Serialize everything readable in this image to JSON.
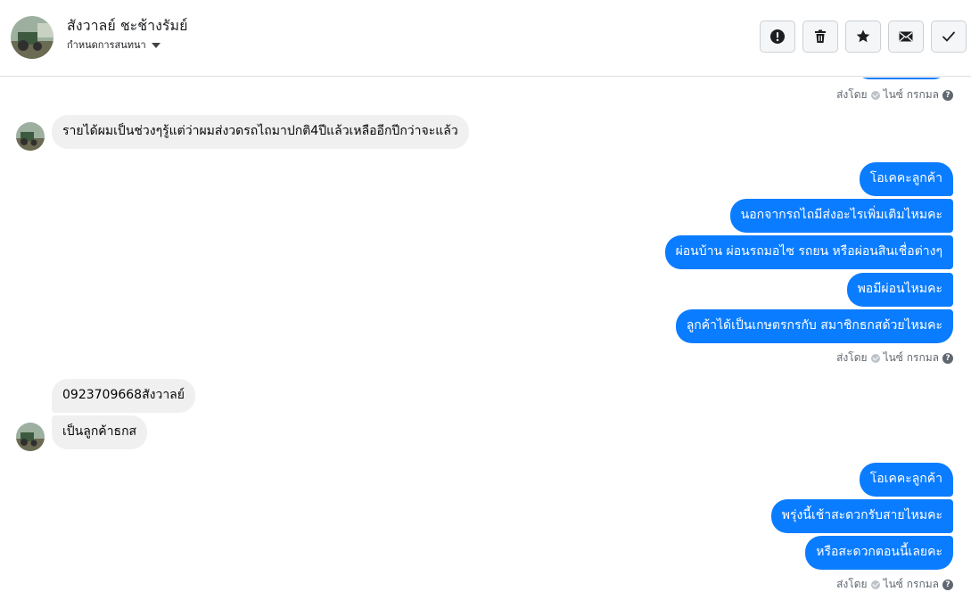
{
  "header": {
    "contact_name": "สังวาลย์ ชะช้างรัมย์",
    "settings_label": "กำหนดการสนทนา"
  },
  "actions": {
    "icons": [
      "alert-icon",
      "trash-icon",
      "star-icon",
      "envelope-icon",
      "check-icon"
    ]
  },
  "sent_by": {
    "prefix": "ส่งโดย",
    "name": "ไนซ์ กรกมล",
    "help": "?"
  },
  "messages": [
    {
      "direction": "in",
      "text": "รายได้ผมเป็นช่วงๆรู้แต่ว่าผมส่งวดรถไถมาปกติ4ปีแล้วเหลืออีกปีกว่าจะแล้ว"
    },
    {
      "direction": "out",
      "text": "โอเคคะลูกค้า"
    },
    {
      "direction": "out",
      "text": "นอกจากรถไถมีส่งอะไรเพิ่มเติมไหมคะ"
    },
    {
      "direction": "out",
      "text": "ผ่อนบ้าน ผ่อนรถมอไซ รถยน หรือผ่อนสินเชื่อต่างๆ"
    },
    {
      "direction": "out",
      "text": "พอมีผ่อนไหมคะ"
    },
    {
      "direction": "out",
      "text": "ลูกค้าได้เป็นเกษตรกรกับ สมาชิกธกสด้วยไหมคะ"
    },
    {
      "direction": "in",
      "text": "0923709668สังวาลย์"
    },
    {
      "direction": "in",
      "text": "เป็นลูกค้าธกส"
    },
    {
      "direction": "out",
      "text": "โอเคคะลูกค้า"
    },
    {
      "direction": "out",
      "text": "พรุ่งนี้เช้าสะดวกรับสายไหมคะ"
    },
    {
      "direction": "out",
      "text": "หรือสะดวกตอนนี้เลยคะ"
    }
  ],
  "colors": {
    "outgoing_bubble": "#0a7cff",
    "incoming_bubble": "#f0f0f0"
  }
}
